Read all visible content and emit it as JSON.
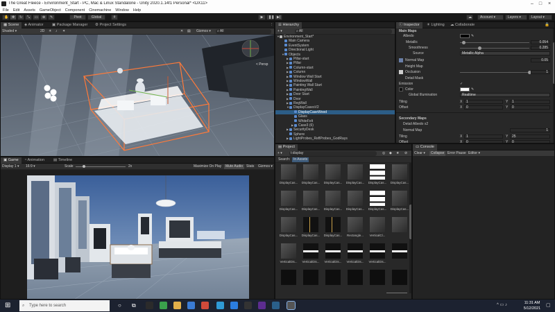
{
  "window": {
    "title": "The Great Fleece - Environment_Start - PC, Mac & Linux Standalone - Unity 2020.1.14f1 Personal* <DX11>"
  },
  "menu": [
    "File",
    "Edit",
    "Assets",
    "GameObject",
    "Component",
    "Cinemachine",
    "Window",
    "Help"
  ],
  "toolbar": {
    "pivot": "Pivot",
    "global": "Global",
    "account": "Account",
    "layers": "Layers",
    "layout": "Layout"
  },
  "scene_panel": {
    "tabs": [
      "Scene",
      "Animator",
      "Package Manager",
      "Project Settings"
    ],
    "shading": "Shaded",
    "mode_2d": "2D",
    "gizmos": "Gizmos",
    "search_all": "All",
    "persp": "< Persp"
  },
  "game_panel": {
    "tabs": [
      "Game",
      "Animation",
      "Timeline"
    ],
    "display": "Display 1",
    "aspect": "16:9",
    "scale_label": "Scale",
    "scale_value": "2x",
    "maximize": "Maximize On Play",
    "mute": "Mute Audio",
    "stats": "Stats",
    "gizmos": "Gizmos"
  },
  "hierarchy": {
    "tab": "Hierarchy",
    "search_all": "All",
    "items": [
      {
        "label": "Environment_Start*",
        "depth": 0,
        "arrow": "▼",
        "scene": true
      },
      {
        "label": "Main Camera",
        "depth": 1,
        "arrow": ""
      },
      {
        "label": "EventSystem",
        "depth": 1,
        "arrow": ""
      },
      {
        "label": "Directional Light",
        "depth": 1,
        "arrow": ""
      },
      {
        "label": "Objects",
        "depth": 1,
        "arrow": "▼"
      },
      {
        "label": "Pillar-start",
        "depth": 2,
        "arrow": "▶"
      },
      {
        "label": "Pillar",
        "depth": 2,
        "arrow": "▶"
      },
      {
        "label": "Column-start",
        "depth": 2,
        "arrow": "▶"
      },
      {
        "label": "Column",
        "depth": 2,
        "arrow": "▶"
      },
      {
        "label": "Window Wall Start",
        "depth": 2,
        "arrow": "▶"
      },
      {
        "label": "WindowWall",
        "depth": 2,
        "arrow": "▶"
      },
      {
        "label": "Painting Wall Start",
        "depth": 2,
        "arrow": "▶"
      },
      {
        "label": "PaintingWall",
        "depth": 2,
        "arrow": "▶"
      },
      {
        "label": "Door Start",
        "depth": 2,
        "arrow": "▶"
      },
      {
        "label": "Door",
        "depth": 2,
        "arrow": "▶"
      },
      {
        "label": "RegWall",
        "depth": 2,
        "arrow": "▶"
      },
      {
        "label": "DisplayCasesV2",
        "depth": 2,
        "arrow": "▼"
      },
      {
        "label": "DisplayCaseWood",
        "depth": 3,
        "arrow": "",
        "selected": true
      },
      {
        "label": "Glass",
        "depth": 3,
        "arrow": ""
      },
      {
        "label": "WhiteFelt",
        "depth": 3,
        "arrow": ""
      },
      {
        "label": "Case3 (6)",
        "depth": 3,
        "arrow": "▶"
      },
      {
        "label": "SecurityDesk",
        "depth": 2,
        "arrow": "▶"
      },
      {
        "label": "Sphere",
        "depth": 2,
        "arrow": ""
      },
      {
        "label": "LightProbes_ReflProbes_GodRays",
        "depth": 2,
        "arrow": "▶"
      }
    ]
  },
  "inspector": {
    "tabs": [
      "Inspector",
      "Lighting",
      "Collaborate"
    ],
    "main_maps": "Main Maps",
    "albedo": "Albedo",
    "metallic": "Metallic",
    "metallic_value": "0.054",
    "metallic_level": 0.054,
    "smoothness": "Smoothness",
    "smoothness_value": "0.285",
    "smoothness_level": 0.285,
    "source": "Source",
    "source_value": "Metallic Alpha",
    "normal_map": "Normal Map",
    "normal_value": "0.05",
    "height_map": "Height Map",
    "occlusion": "Occlusion",
    "occlusion_value": "1",
    "occlusion_level": 1,
    "detail_mask": "Detail Mask",
    "emission": "Emission",
    "color": "Color",
    "gi": "Global Illumination",
    "gi_value": "Realtime",
    "tiling": "Tiling",
    "offset": "Offset",
    "tiling_x": "1",
    "tiling_y": "1",
    "offset_x": "0",
    "offset_y": "0",
    "secondary_maps": "Secondary Maps",
    "detail_albedo": "Detail Albedo x2",
    "sec_normal": "Normal Map",
    "sec_normal_value": "1",
    "sec_tiling_x": "1",
    "sec_tiling_y": "25",
    "sec_offset_x": "0",
    "sec_offset_y": "0",
    "x": "X",
    "y": "Y"
  },
  "project_panel": {
    "tab": "Project",
    "search_value": "t:display",
    "search_label": "Search:",
    "in_assets": "In Assets",
    "assets": [
      "DisplayCas...",
      "DisplayCas...",
      "DisplayCas...",
      "DisplayCas...",
      "DisplayCas...",
      "DisplayCas...",
      "DisplayCas...",
      "DisplayCas...",
      "DisplayCas...",
      "DisplayCas...",
      "DisplayCas...",
      "DisplayCas...",
      "DisplayCas...",
      "DisplayCas...",
      "DisplayCas...",
      "Rectangle...",
      "VerticalCl...",
      "",
      "VerticalDis...",
      "VerticalDis...",
      "VerticalDis...",
      "VerticalDis...",
      "VerticalDis...",
      "",
      "",
      "",
      "",
      "",
      "",
      ""
    ]
  },
  "console_panel": {
    "tab": "Console",
    "clear": "Clear",
    "collapse": "Collapse",
    "error_pause": "Error Pause",
    "editor": "Editor"
  },
  "taskbar": {
    "search_placeholder": "Type here to search",
    "time": "11:31 AM",
    "date": "5/12/2021"
  },
  "colors": {
    "accent": "#2c5d87",
    "panel": "#282828",
    "selection_orange": "#ff7a3a"
  }
}
